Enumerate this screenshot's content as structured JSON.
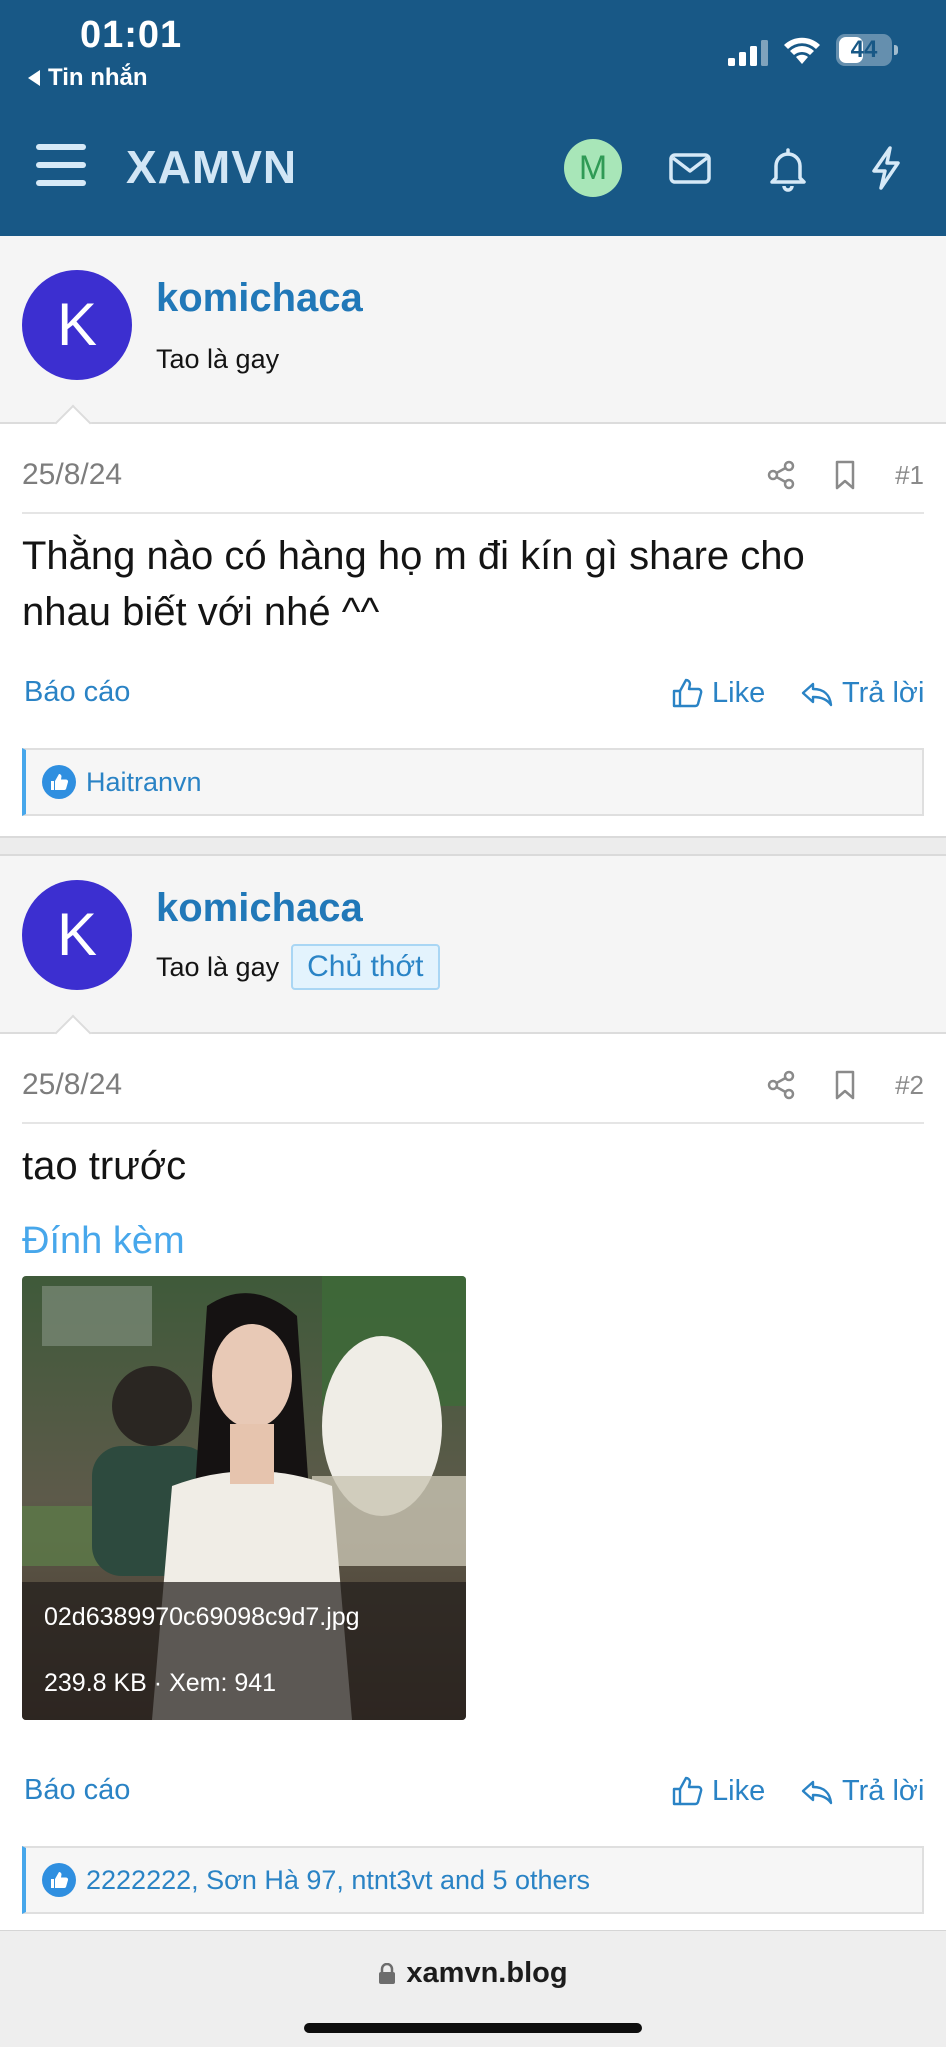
{
  "status_bar": {
    "time": "01:01",
    "back_label": "Tin nhắn",
    "battery": "44"
  },
  "header": {
    "logo": "XAMVN",
    "avatar_letter": "M",
    "icons": [
      "menu-icon",
      "envelope-icon",
      "bell-icon",
      "lightning-icon"
    ]
  },
  "posts": [
    {
      "avatar_letter": "K",
      "username": "komichaca",
      "user_title": "Tao là gay",
      "date": "25/8/24",
      "number": "#1",
      "content": "Thằng nào có hàng họ m đi kín gì share cho nhau biết với nhé ^^",
      "actions": {
        "report": "Báo cáo",
        "like": "Like",
        "reply": "Trả lời"
      },
      "reactions": "Haitranvn"
    },
    {
      "avatar_letter": "K",
      "username": "komichaca",
      "user_title": "Tao là gay",
      "badge": "Chủ thớt",
      "date": "25/8/24",
      "number": "#2",
      "content": "tao trước",
      "attachments_title": "Đính kèm",
      "attachment": {
        "filename": "02d6389970c69098c9d7.jpg",
        "meta": "239.8 KB · Xem: 941"
      },
      "actions": {
        "report": "Báo cáo",
        "like": "Like",
        "reply": "Trả lời"
      },
      "reactions": "2222222, Sơn Hà 97, ntnt3vt and 5 others"
    }
  ],
  "browser": {
    "url": "xamvn.blog"
  },
  "colors": {
    "header_bg": "#185886",
    "link": "#2a83c5",
    "avatar": "#3c2fd0",
    "username": "#2178b8"
  }
}
